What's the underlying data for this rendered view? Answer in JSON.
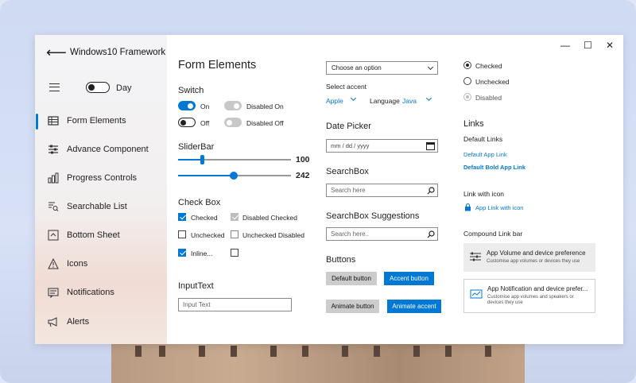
{
  "window": {
    "minimize": "—",
    "maximize": "☐",
    "close": "✕"
  },
  "sidebar": {
    "title": "Windows10 Framework",
    "theme_label": "Day",
    "items": [
      {
        "label": "Form Elements",
        "icon": "table-icon"
      },
      {
        "label": "Advance Component",
        "icon": "sliders-icon"
      },
      {
        "label": "Progress Controls",
        "icon": "chart-icon"
      },
      {
        "label": "Searchable List",
        "icon": "search-list-icon"
      },
      {
        "label": "Bottom Sheet",
        "icon": "bottom-sheet-icon"
      },
      {
        "label": "Icons",
        "icon": "warning-icon"
      },
      {
        "label": "Notifications",
        "icon": "notification-icon"
      },
      {
        "label": "Alerts",
        "icon": "megaphone-icon"
      }
    ]
  },
  "form": {
    "title": "Form Elements",
    "switch": {
      "heading": "Switch",
      "on": "On",
      "off": "Off",
      "disabled_on": "Disabled On",
      "disabled_off": "Disabled Off"
    },
    "slider": {
      "heading": "SliderBar",
      "value1": "100",
      "value2": "242"
    },
    "checkbox": {
      "heading": "Check Box",
      "checked": "Checked",
      "disabled_checked": "Disabled Checked",
      "unchecked": "Unchecked",
      "unchecked_disabled": "Unchecked Disabled",
      "inline": "Inline..."
    },
    "input": {
      "heading": "InputText",
      "placeholder": "Input Text"
    }
  },
  "middle": {
    "combo": "Choose an option",
    "select_accent": "Select accent",
    "accent_value": "Apple",
    "language_label": "Language",
    "language_value": "Java",
    "date_picker": {
      "heading": "Date Picker",
      "placeholder": "mm / dd / yyyy"
    },
    "searchbox": {
      "heading": "SearchBox",
      "placeholder": "Search here"
    },
    "suggestions": {
      "heading": "SearchBox Suggestions",
      "placeholder": "Search here.."
    },
    "buttons": {
      "heading": "Buttons",
      "default": "Default button",
      "accent": "Accent button",
      "animate": "Animate button",
      "animate_accent": "Animate accent"
    }
  },
  "right": {
    "radios": {
      "checked": "Checked",
      "unchecked": "Unchecked",
      "disabled": "Disabled"
    },
    "links": {
      "heading": "Links",
      "default": "Default Links",
      "app": "Default App Link",
      "bold": "Default Bold App Link"
    },
    "link_icon": {
      "heading": "Link with icon",
      "label": "App Link with icon"
    },
    "compound": {
      "heading": "Compound Link bar",
      "card1_title": "App Volume and device preference",
      "card1_sub": "Customise app volumes or devices they use",
      "card2_title": "App Notification and device prefer...",
      "card2_sub": "Customise app volumes and speakers or devices they use"
    }
  },
  "colors": {
    "accent": "#0078d4"
  }
}
